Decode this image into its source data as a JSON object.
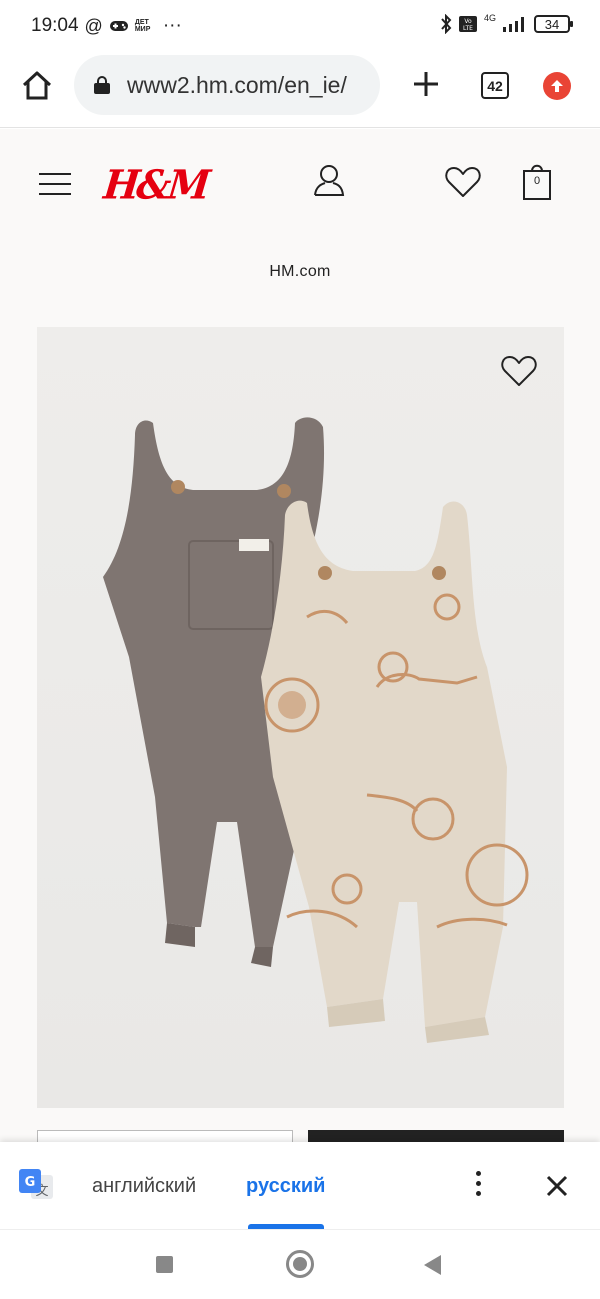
{
  "status_bar": {
    "time": "19:04",
    "at_symbol": "@",
    "app_badge": "ДЕТ МИР",
    "more": "···",
    "network": "4G",
    "battery": "34"
  },
  "browser": {
    "url": "www2.hm.com/en_ie/",
    "tab_count": "42"
  },
  "site": {
    "logo": "H&M",
    "bag_count": "0",
    "label": "HM.com",
    "brand_color": "#e50010"
  },
  "translate_bar": {
    "source_lang": "английский",
    "target_lang": "русский",
    "accent_color": "#1a73e8"
  },
  "icons": {
    "home": "home-icon",
    "lock": "lock-icon",
    "plus": "plus-icon",
    "update": "update-arrow-icon",
    "menu": "hamburger-icon",
    "account": "account-icon",
    "wishlist": "heart-icon",
    "bag": "shopping-bag-icon",
    "translate": "google-translate-icon",
    "more": "more-vert-icon",
    "close": "close-icon"
  }
}
